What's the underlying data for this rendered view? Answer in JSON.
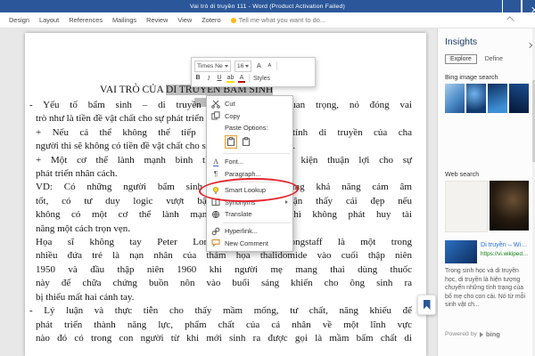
{
  "title_bar": {
    "title": "Vai trò di truyền 111 - Word (Product Activation Failed)"
  },
  "ribbon": {
    "tabs": [
      "Design",
      "Layout",
      "References",
      "Mailings",
      "Review",
      "View",
      "Zotero"
    ],
    "tell_me": "Tell me what you want to do..."
  },
  "mini_toolbar": {
    "font_name": "Times Ne",
    "font_size": "16",
    "grow_font": "A",
    "shrink_font": "A",
    "bold": "B",
    "italic": "I",
    "underline": "U",
    "highlight": "ab",
    "font_color": "A",
    "styles": "Styles"
  },
  "context_menu": {
    "items": [
      {
        "label": "Cut",
        "icon": "scissors-icon"
      },
      {
        "label": "Copy",
        "icon": "copy-icon"
      },
      {
        "label": "Paste Options:",
        "icon": "none"
      },
      {
        "label": "Font...",
        "icon": "font-icon"
      },
      {
        "label": "Paragraph...",
        "icon": "paragraph-mark-icon"
      },
      {
        "label": "Smart Lookup",
        "icon": "lightbulb-icon"
      },
      {
        "label": "Synonyms",
        "icon": "book-icon"
      },
      {
        "label": "Translate",
        "icon": "translate-globe-icon"
      },
      {
        "label": "Hyperlink...",
        "icon": "hyperlink-icon"
      },
      {
        "label": "New Comment",
        "icon": "comment-icon"
      }
    ]
  },
  "annotation": {
    "shape": "ellipse",
    "around": "Smart Lookup",
    "color": "#e5232b"
  },
  "document": {
    "title_prefix": "VAI TRÒ CỦA ",
    "title_selected": "DI TRUYỀN BẨM SINH",
    "selection_color": "#bdbdbd",
    "lines": [
      "- Yếu tố bẩm sinh – di truyền đóng vai trò quan trọng, nó đóng vai",
      "trò như là tiền đề vật chất cho sự phát triển của cá nhân.",
      "+ Nếu cá thể không thể tiếp nhận được đặc tính di truyền của cha",
      "người thì sẽ không có tiền đề vật chất cho sự phát triển nhân cách.",
      "+ Một cơ thể lành mạnh bình thường sẽ là điều kiện thuận lợi cho sự",
      "phát triển nhân cách.",
      "VD: Có những người bẩm sinh đã có sẵn những khả năng cảm âm",
      "tốt, có tư duy logic vượt bậc, hay cảm nhận thấy cái đẹp nếu",
      "không có một cơ thể lành mạnh bình thường thì không phát huy tài",
      "năng một cách trọn vẹn.",
      "Họa sĩ không tay Peter Longstaff.  Peter Longstaff là một trong",
      "nhiều đứa trẻ là nạn nhân của thảm họa thalidomide vào cuối thập niên",
      "1950 và đầu thập niên 1960 khi người mẹ mang thai dùng thuốc",
      "này để chữa chứng buồn nôn vào buổi sáng khiến cho ông sinh ra",
      "bị thiếu mất hai cánh tay.",
      "- Lý luận và thực tiễn cho thấy mầm mống, tư chất, năng khiếu để",
      "phát triển thành năng lực, phẩm chất của cá nhân về một lĩnh vực",
      "nào đó có trong con người từ khi mới sinh ra được gọi là mầm bẩm chất di"
    ]
  },
  "insights": {
    "title": "Insights",
    "tabs": [
      {
        "label": "Explore",
        "selected": true
      },
      {
        "label": "Define",
        "selected": false
      }
    ],
    "image_search_label": "Bing image search",
    "web_search_label": "Web search",
    "result": {
      "title": "Di truyền – Wikipedia...",
      "url": "https://vi.wikipedia.org/wiki/Di_truyền",
      "snippet": "Trong sinh học và di truyền học, di truyền là hiện tượng chuyển những tính trạng của bố mẹ cho con cái. Nó từ mỗi sinh vật ch..."
    },
    "powered_by": "Powered by",
    "brand": "bing",
    "accent_color": "#2b579a"
  }
}
